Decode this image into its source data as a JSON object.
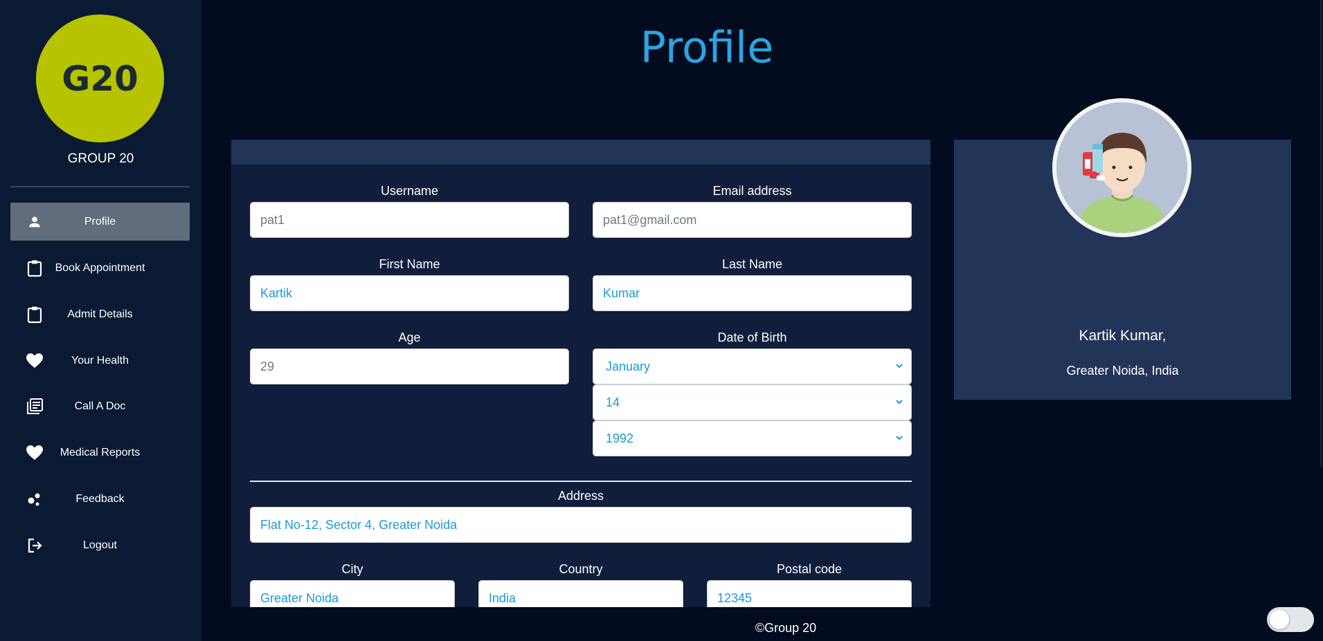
{
  "brand": {
    "logo_text": "G20",
    "name": "GROUP 20",
    "logo_color": "#b8c300"
  },
  "sidebar": {
    "items": [
      {
        "label": "Profile",
        "icon": "user-icon",
        "active": true
      },
      {
        "label": "Book Appointment",
        "icon": "clipboard-icon",
        "active": false
      },
      {
        "label": "Admit Details",
        "icon": "clipboard-icon",
        "active": false
      },
      {
        "label": "Your Health",
        "icon": "heart-icon",
        "active": false
      },
      {
        "label": "Call A Doc",
        "icon": "library-books-icon",
        "active": false
      },
      {
        "label": "Medical Reports",
        "icon": "heart-icon",
        "active": false
      },
      {
        "label": "Feedback",
        "icon": "bubble-chart-icon",
        "active": false
      },
      {
        "label": "Logout",
        "icon": "logout-icon",
        "active": false
      }
    ]
  },
  "page": {
    "title": "Profile",
    "accent_color": "#2ba4e0"
  },
  "form": {
    "username": {
      "label": "Username",
      "value": "pat1"
    },
    "email": {
      "label": "Email address",
      "value": "pat1@gmail.com"
    },
    "first_name": {
      "label": "First Name",
      "value": "Kartik"
    },
    "last_name": {
      "label": "Last Name",
      "value": "Kumar"
    },
    "age": {
      "label": "Age",
      "value": "29"
    },
    "dob": {
      "label": "Date of Birth",
      "month": "January",
      "day": "14",
      "year": "1992"
    },
    "address": {
      "label": "Address",
      "value": "Flat No-12, Sector 4, Greater Noida"
    },
    "city": {
      "label": "City",
      "value": "Greater Noida"
    },
    "country": {
      "label": "Country",
      "value": "India"
    },
    "postal_code": {
      "label": "Postal code",
      "value": "12345"
    }
  },
  "profile_card": {
    "name": "Kartik Kumar,",
    "location": "Greater Noida, India"
  },
  "footer": {
    "text": "©Group 20"
  }
}
